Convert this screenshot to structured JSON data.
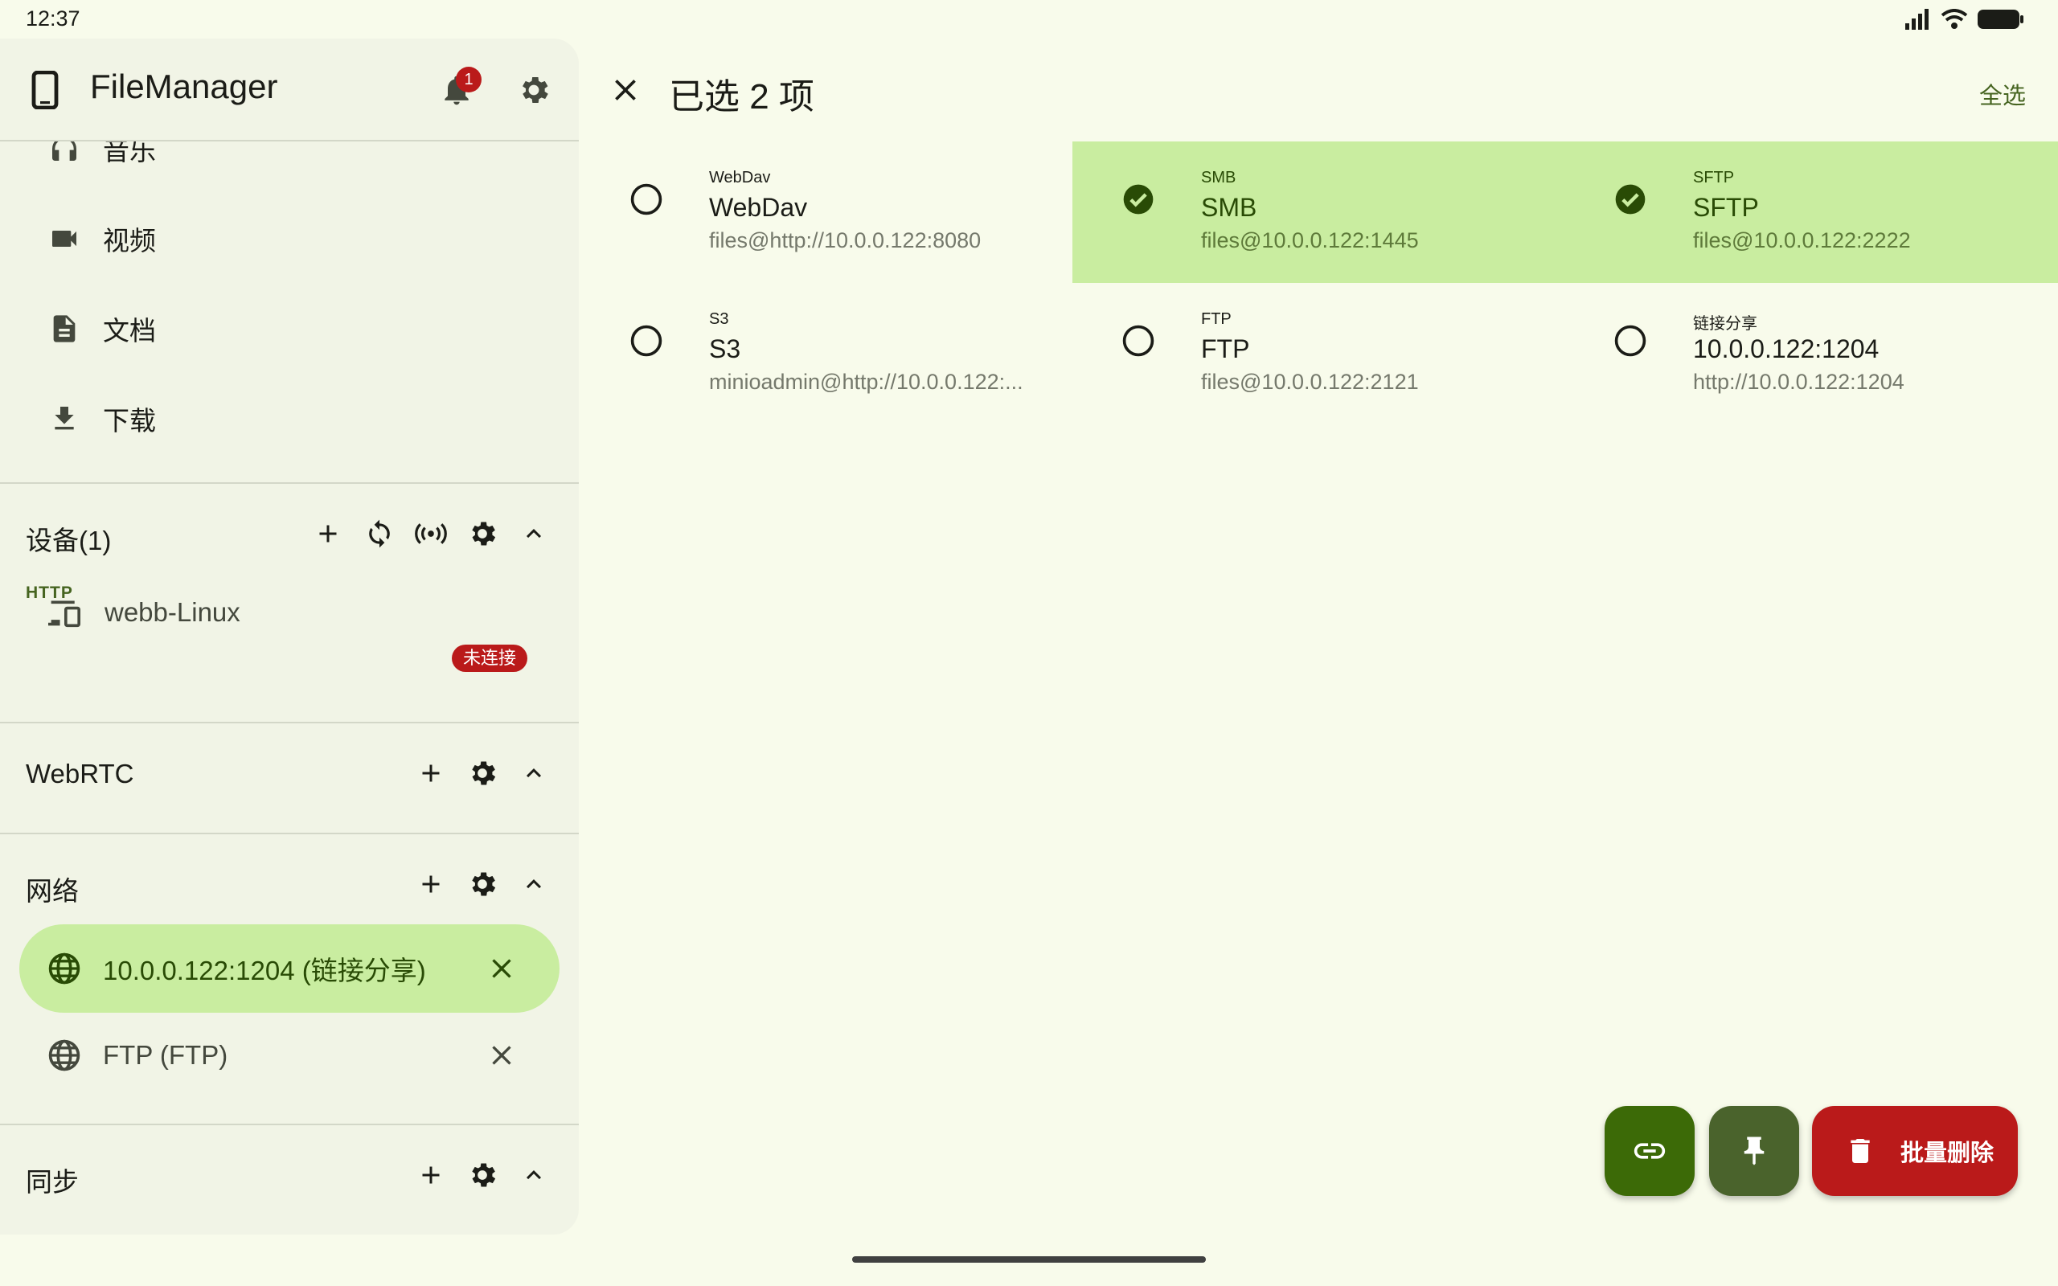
{
  "status_bar": {
    "time": "12:37"
  },
  "sidebar": {
    "app_title": "FileManager",
    "notification_count": "1",
    "nav_items": [
      {
        "label": "音乐",
        "icon": "headphones-icon"
      },
      {
        "label": "视频",
        "icon": "videocam-icon"
      },
      {
        "label": "文档",
        "icon": "document-icon"
      },
      {
        "label": "下载",
        "icon": "download-icon"
      }
    ],
    "devices": {
      "title": "设备(1)",
      "subheader": "HTTP",
      "items": [
        {
          "label": "webb-Linux",
          "status": "未连接"
        }
      ]
    },
    "webrtc": {
      "title": "WebRTC"
    },
    "network": {
      "title": "网络",
      "items": [
        {
          "label": "10.0.0.122:1204 (链接分享)",
          "active": true
        },
        {
          "label": "FTP (FTP)",
          "active": false
        }
      ]
    },
    "sync": {
      "title": "同步"
    }
  },
  "topbar": {
    "selection_title": "已选 2 项",
    "select_all": "全选"
  },
  "servers": [
    {
      "type": "WebDav",
      "name": "WebDav",
      "address": "files@http://10.0.0.122:8080",
      "selected": false
    },
    {
      "type": "SMB",
      "name": "SMB",
      "address": "files@10.0.0.122:1445",
      "selected": true
    },
    {
      "type": "SFTP",
      "name": "SFTP",
      "address": "files@10.0.0.122:2222",
      "selected": true
    },
    {
      "type": "S3",
      "name": "S3",
      "address": "minioadmin@http://10.0.0.122:...",
      "selected": false
    },
    {
      "type": "FTP",
      "name": "FTP",
      "address": "files@10.0.0.122:2121",
      "selected": false
    },
    {
      "type": "链接分享",
      "name": "10.0.0.122:1204",
      "address": "http://10.0.0.122:1204",
      "selected": false
    }
  ],
  "fabs": {
    "delete_label": "批量删除"
  },
  "colors": {
    "background": "#f8fbeb",
    "sidebar": "#f1f4e6",
    "selected": "#c9eda0",
    "primary": "#3c6a07",
    "danger": "#ba1a1a"
  }
}
